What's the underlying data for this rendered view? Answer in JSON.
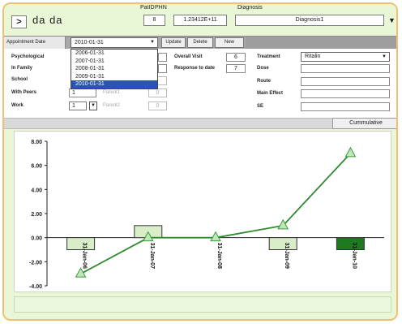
{
  "header": {
    "patient_name": "da da",
    "back_label": ">",
    "patid_label": "PatID",
    "patid_value": "8",
    "phn_label": "PHN",
    "phn_value": "1.23412E+11",
    "diagnosis_label": "Diagnosis",
    "diagnosis_value": "Diagnosis1",
    "diagnosis_arrow": "▼"
  },
  "tabs": {
    "appointment_label": "Appointment Date",
    "appointment_value": "2010-01-31",
    "update_label": "Update",
    "delete_label": "Delete",
    "new_label": "New"
  },
  "dropdown": {
    "options": [
      "2006-01-31",
      "2007-01-31",
      "2008-01-31",
      "2009-01-31",
      "2010-01-31"
    ],
    "selected": "2010-01-31"
  },
  "form": {
    "psychological_label": "Psychological",
    "in_family_label": "In Family",
    "school_label": "School",
    "with_peers_label": "With Peers",
    "with_peers_value": "1",
    "parent1_label": "Parent1",
    "parent1_value": "0",
    "work_label": "Work",
    "work_value": "1",
    "parent2_label": "Parent2",
    "parent2_value": "0",
    "overall_visit_label": "Overall Visit",
    "overall_visit_value": "6",
    "response_label": "Response to date",
    "response_value": "7",
    "treatment_label": "Treatment",
    "treatment_value": "Ritalin",
    "dose_label": "Dose",
    "route_label": "Route",
    "main_effect_label": "Main Effect",
    "se_label": "SE"
  },
  "cumulative_label": "Cummulative",
  "colors": {
    "frame_border": "#f0c070",
    "background": "#e9f7d6",
    "line": "#2e8b2e",
    "bar_fill": "#d8edc8",
    "bar_highlight": "#1e7a1e",
    "marker": "#bfe8b8"
  },
  "chart_data": {
    "type": "bar",
    "categories": [
      "31-Jan-06",
      "31-Jan-07",
      "31-Jan-08",
      "31-Jan-09",
      "31-Jan-10"
    ],
    "values": [
      -1,
      1,
      0,
      -1,
      -1
    ],
    "line_values": [
      -3,
      0,
      0,
      1,
      7
    ],
    "ylim": [
      -4,
      8
    ],
    "yticks": [
      "8.00",
      "6.00",
      "4.00",
      "2.00",
      "0.00",
      "-2.00",
      "-4.00"
    ],
    "grid": false,
    "highlight_index": 4
  }
}
